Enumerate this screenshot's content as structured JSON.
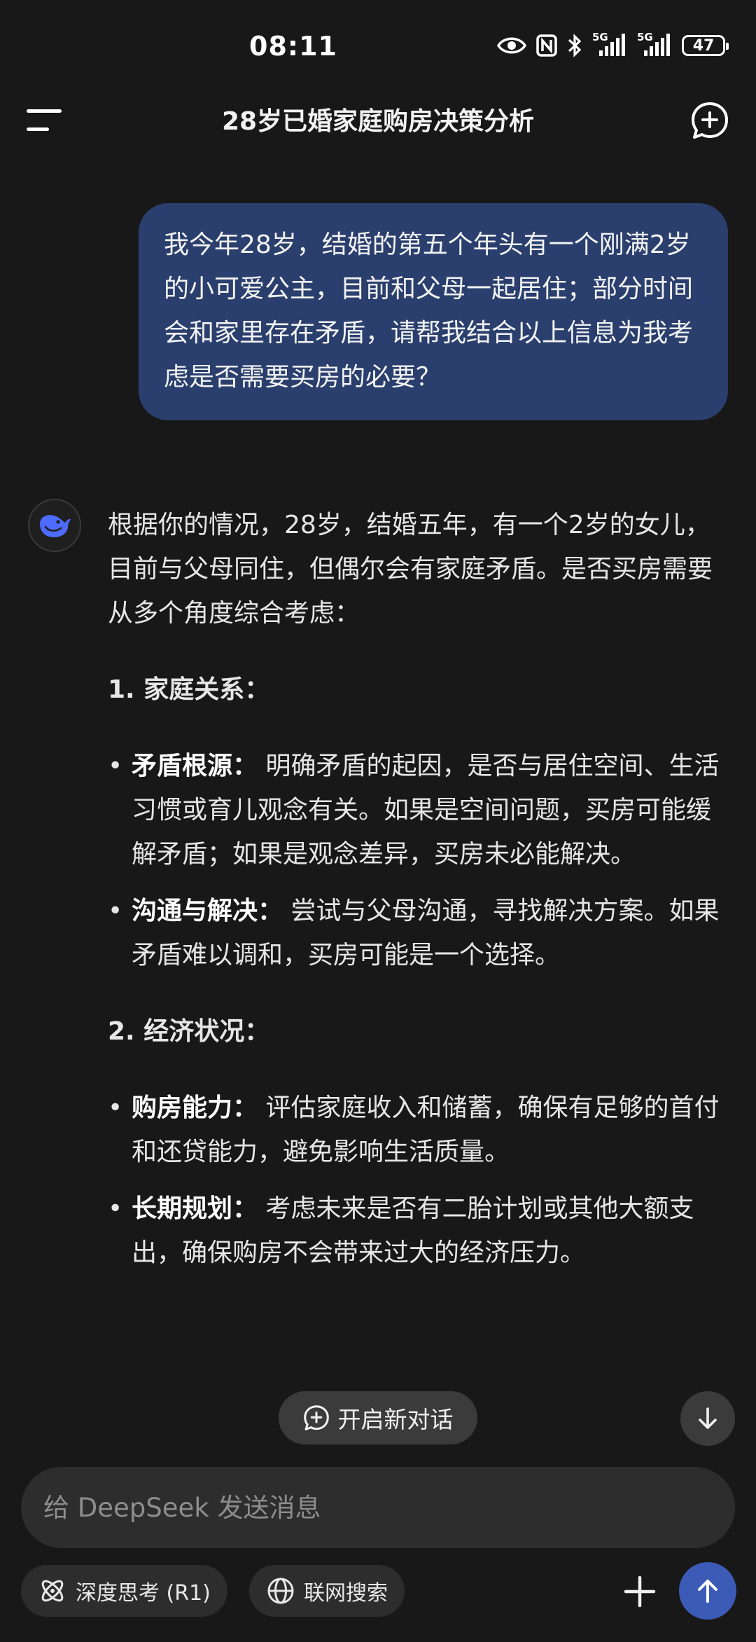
{
  "status_bar": {
    "time": "08:11",
    "network_1": "5G",
    "network_2": "5G",
    "battery": "47",
    "icons": [
      "eye-icon",
      "nfc-icon",
      "bluetooth-icon",
      "signal-icon",
      "signal-icon",
      "battery-icon"
    ]
  },
  "header": {
    "title": "28岁已婚家庭购房决策分析",
    "menu_icon": "menu-icon",
    "new_chat_icon": "new-chat-icon"
  },
  "conversation": {
    "user_message": "我今年28岁，结婚的第五个年头有一个刚满2岁的小可爱公主，目前和父母一起居住；部分时间会和家里存在矛盾，请帮我结合以上信息为我考虑是否需要买房的必要？",
    "assistant": {
      "avatar_icon": "deepseek-whale-icon",
      "intro": "根据你的情况，28岁，结婚五年，有一个2岁的女儿，目前与父母同住，但偶尔会有家庭矛盾。是否买房需要从多个角度综合考虑：",
      "sections": [
        {
          "heading": "1. 家庭关系：",
          "items": [
            {
              "label": "矛盾根源：",
              "text": " 明确矛盾的起因，是否与居住空间、生活习惯或育儿观念有关。如果是空间问题，买房可能缓解矛盾；如果是观念差异，买房未必能解决。"
            },
            {
              "label": "沟通与解决：",
              "text": " 尝试与父母沟通，寻找解决方案。如果矛盾难以调和，买房可能是一个选择。"
            }
          ]
        },
        {
          "heading": "2. 经济状况：",
          "items": [
            {
              "label": "购房能力：",
              "text": " 评估家庭收入和储蓄，确保有足够的首付和还贷能力，避免影响生活质量。"
            },
            {
              "label": "长期规划：",
              "text": " 考虑未来是否有二胎计划或其他大额支出，确保购房不会带来过大的经济压力。"
            }
          ]
        }
      ]
    }
  },
  "floating": {
    "new_conversation_label": "开启新对话"
  },
  "composer": {
    "placeholder": "给 DeepSeek 发送消息",
    "deep_think_label": "深度思考 (R1)",
    "web_search_label": "联网搜索"
  },
  "colors": {
    "background": "#181818",
    "user_bubble": "#2a3f6d",
    "accent": "#3c5bb7",
    "avatar_blue": "#4d6bfe"
  }
}
